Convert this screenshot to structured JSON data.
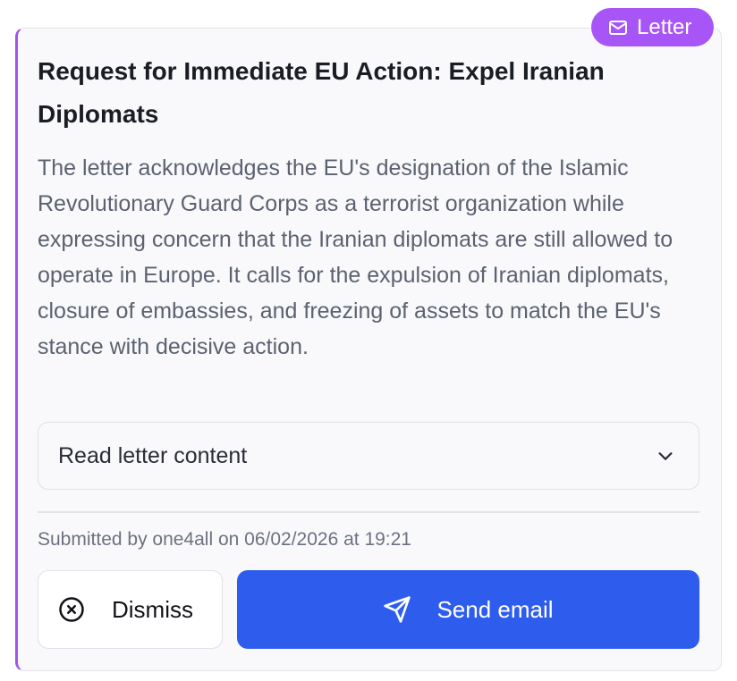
{
  "badge": {
    "label": "Letter",
    "icon": "mail-icon",
    "color": "#a855f7"
  },
  "card": {
    "title": "Request for Immediate EU Action: Expel Iranian Diplomats",
    "description": "The letter acknowledges the EU's designation of the Islamic Revolutionary Guard Corps as a terrorist organization while expressing concern that the Iranian diplomats are still allowed to operate in Europe. It calls for the expulsion of Iranian diplomats, closure of embassies, and freezing of assets to match the EU's stance with decisive action.",
    "accent_color": "#a155e9"
  },
  "accordion": {
    "label": "Read letter content",
    "icon": "chevron-down-icon"
  },
  "meta": {
    "submitted": "Submitted by one4all on 06/02/2026 at 19:21"
  },
  "actions": {
    "dismiss_label": "Dismiss",
    "dismiss_icon": "x-circle-icon",
    "send_label": "Send email",
    "send_icon": "send-icon",
    "send_color": "#2e5ded"
  }
}
